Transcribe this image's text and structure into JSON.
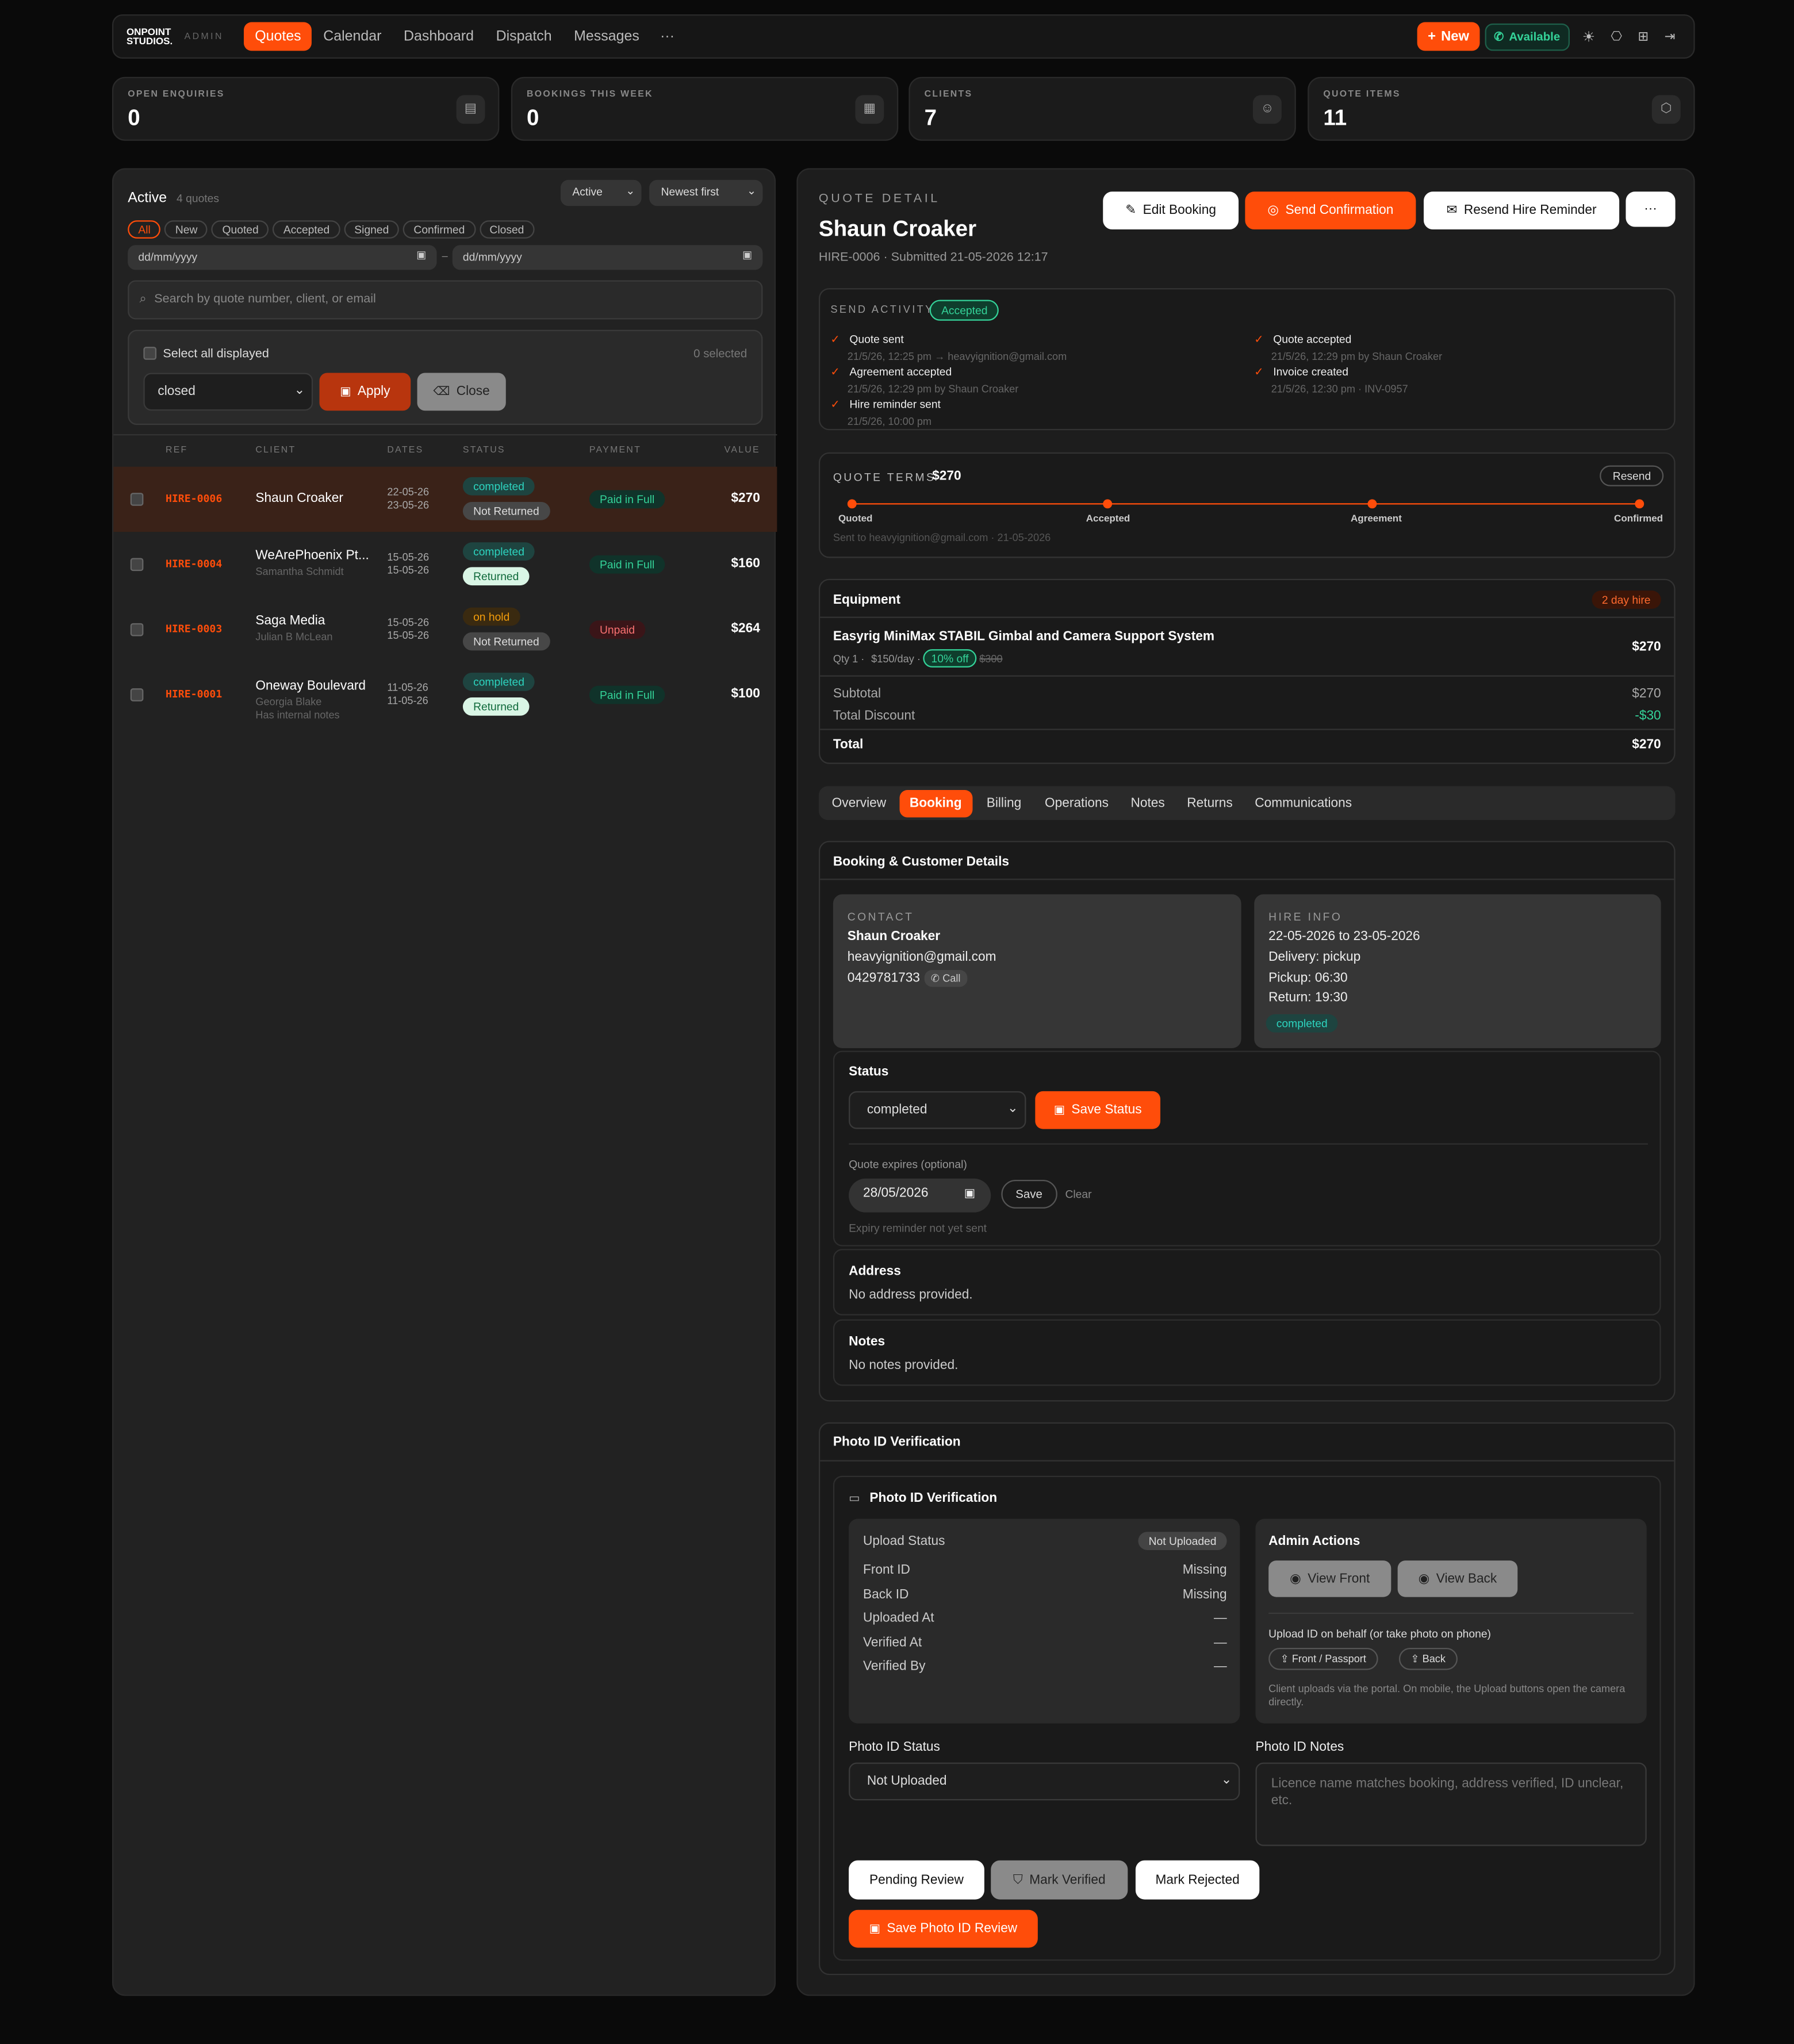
{
  "nav": {
    "logo_line1": "ONPOINT",
    "logo_line2": "STUDIOS.",
    "admin": "ADMIN",
    "tabs": [
      "Quotes",
      "Calendar",
      "Dashboard",
      "Dispatch",
      "Messages"
    ],
    "more": "···",
    "new": "New",
    "available": "Available"
  },
  "stats": [
    {
      "label": "OPEN ENQUIRIES",
      "value": "0",
      "icon": "clipboard-icon"
    },
    {
      "label": "BOOKINGS THIS WEEK",
      "value": "0",
      "icon": "calendar-icon"
    },
    {
      "label": "CLIENTS",
      "value": "7",
      "icon": "user-icon"
    },
    {
      "label": "QUOTE ITEMS",
      "value": "11",
      "icon": "box-icon"
    }
  ],
  "list": {
    "title": "Active",
    "count": "4 quotes",
    "filter_select": "Active",
    "sort_select": "Newest first",
    "pills": [
      "All",
      "New",
      "Quoted",
      "Accepted",
      "Signed",
      "Confirmed",
      "Closed"
    ],
    "date_from": "dd/mm/yyyy",
    "date_sep": "–",
    "date_to": "dd/mm/yyyy",
    "search_placeholder": "Search by quote number, client, or email",
    "select_all": "Select all displayed",
    "selected": "0 selected",
    "bulk_value": "closed",
    "apply": "Apply",
    "close": "Close",
    "columns": [
      "REF",
      "CLIENT",
      "DATES",
      "STATUS",
      "PAYMENT",
      "VALUE"
    ],
    "rows": [
      {
        "ref": "HIRE-0006",
        "client": "Shaun Croaker",
        "sub": "",
        "sub2": "",
        "d1": "22-05-26",
        "d2": "23-05-26",
        "status": "completed",
        "ret": "Not Returned",
        "ret_on": false,
        "pay": "Paid in Full",
        "paid": true,
        "value": "$270"
      },
      {
        "ref": "HIRE-0004",
        "client": "WeArePhoenix Pt...",
        "sub": "Samantha Schmidt",
        "sub2": "",
        "d1": "15-05-26",
        "d2": "15-05-26",
        "status": "completed",
        "ret": "Returned",
        "ret_on": true,
        "pay": "Paid in Full",
        "paid": true,
        "value": "$160"
      },
      {
        "ref": "HIRE-0003",
        "client": "Saga Media",
        "sub": "Julian B McLean",
        "sub2": "",
        "d1": "15-05-26",
        "d2": "15-05-26",
        "status": "on hold",
        "ret": "Not Returned",
        "ret_on": false,
        "pay": "Unpaid",
        "paid": false,
        "value": "$264"
      },
      {
        "ref": "HIRE-0001",
        "client": "Oneway Boulevard",
        "sub": "Georgia Blake",
        "sub2": "Has internal notes",
        "d1": "11-05-26",
        "d2": "11-05-26",
        "status": "completed",
        "ret": "Returned",
        "ret_on": true,
        "pay": "Paid in Full",
        "paid": true,
        "value": "$100"
      }
    ]
  },
  "detail": {
    "kicker": "QUOTE DETAIL",
    "name": "Shaun Croaker",
    "meta": "HIRE-0006 · Submitted 21-05-2026 12:17",
    "edit": "Edit Booking",
    "send": "Send Confirmation",
    "resend": "Resend Hire Reminder",
    "more": "···",
    "activity": {
      "title": "SEND ACTIVITY",
      "badge": "Accepted",
      "items": [
        {
          "title": "Quote sent",
          "sub": "21/5/26, 12:25 pm → heavyignition@gmail.com"
        },
        {
          "title": "Quote accepted",
          "sub": "21/5/26, 12:29 pm by Shaun Croaker"
        },
        {
          "title": "Agreement accepted",
          "sub": "21/5/26, 12:29 pm by Shaun Croaker"
        },
        {
          "title": "Invoice created",
          "sub": "21/5/26, 12:30 pm · INV-0957"
        },
        {
          "title": "Hire reminder sent",
          "sub": "21/5/26, 10:00 pm"
        }
      ]
    },
    "terms": {
      "title": "QUOTE TERMS",
      "amount": "$270",
      "resend": "Resend",
      "steps": [
        "Quoted",
        "Accepted",
        "Agreement",
        "Confirmed"
      ],
      "sent": "Sent to heavyignition@gmail.com · 21-05-2026"
    },
    "equipment": {
      "title": "Equipment",
      "badge": "2 day hire",
      "item": "Easyrig MiniMax STABIL Gimbal and Camera Support System",
      "qty": "Qty 1",
      "rate": "$150/day",
      "disc": "10% off",
      "orig": "$300",
      "price": "$270",
      "subtotal_l": "Subtotal",
      "subtotal": "$270",
      "discount_l": "Total Discount",
      "discount": "-$30",
      "total_l": "Total",
      "total": "$270"
    },
    "tabs": [
      "Overview",
      "Booking",
      "Billing",
      "Operations",
      "Notes",
      "Returns",
      "Communications"
    ],
    "booking": {
      "title": "Booking & Customer Details",
      "contact": {
        "label": "CONTACT",
        "name": "Shaun Croaker",
        "email": "heavyignition@gmail.com",
        "phone": "0429781733",
        "call": "Call"
      },
      "hire": {
        "label": "HIRE INFO",
        "dates": "22-05-2026 to 23-05-2026",
        "delivery": "Delivery: pickup",
        "pickup": "Pickup: 06:30",
        "return": "Return: 19:30",
        "status": "completed"
      },
      "status_label": "Status",
      "status_value": "completed",
      "save_status": "Save Status",
      "expires_label": "Quote expires (optional)",
      "expires_value": "28/05/2026",
      "save": "Save",
      "clear": "Clear",
      "expiry_note": "Expiry reminder not yet sent",
      "address_label": "Address",
      "address": "No address provided.",
      "notes_label": "Notes",
      "notes": "No notes provided."
    },
    "photo": {
      "title": "Photo ID Verification",
      "inner_title": "Photo ID Verification",
      "upload_status_l": "Upload Status",
      "upload_status": "Not Uploaded",
      "rows": [
        {
          "l": "Front ID",
          "v": "Missing"
        },
        {
          "l": "Back ID",
          "v": "Missing"
        },
        {
          "l": "Uploaded At",
          "v": "—"
        },
        {
          "l": "Verified At",
          "v": "—"
        },
        {
          "l": "Verified By",
          "v": "—"
        }
      ],
      "admin": "Admin Actions",
      "view_front": "View Front",
      "view_back": "View Back",
      "upload_l": "Upload ID on behalf (or take photo on phone)",
      "front": "Front / Passport",
      "back": "Back",
      "upload_note": "Client uploads via the portal. On mobile, the Upload buttons open the camera directly.",
      "status_l": "Photo ID Status",
      "status_v": "Not Uploaded",
      "notes_l": "Photo ID Notes",
      "notes_ph": "Licence name matches booking, address verified, ID unclear, etc.",
      "pending": "Pending Review",
      "verified": "Mark Verified",
      "rejected": "Mark Rejected",
      "save": "Save Photo ID Review"
    }
  }
}
